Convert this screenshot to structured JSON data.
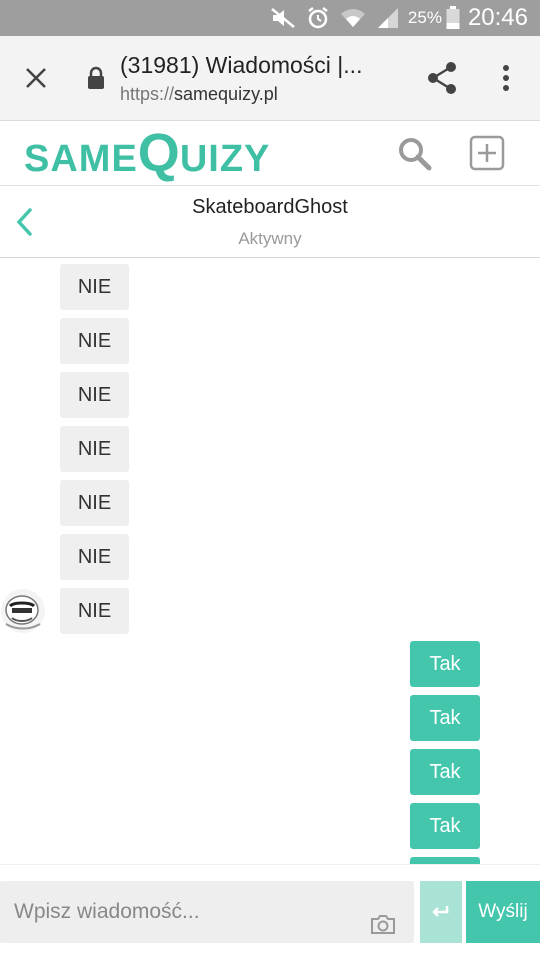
{
  "status_bar": {
    "battery_percent": "25%",
    "time": "20:46",
    "icons": [
      "mute-icon",
      "alarm-icon",
      "wifi-icon",
      "signal-icon",
      "battery-icon"
    ]
  },
  "browser": {
    "tab_title": "(31981) Wiadomości |...",
    "url_protocol": "https://",
    "url_host": "samequizy.pl",
    "icons": [
      "close-icon",
      "lock-icon",
      "share-icon",
      "more-vert-icon"
    ]
  },
  "site": {
    "logo_part1": "SAME",
    "logo_part2": "Q",
    "logo_part3": "UIZY",
    "icons": [
      "search-icon",
      "add-box-icon"
    ]
  },
  "conversation": {
    "name": "SkateboardGhost",
    "status": "Aktywny",
    "back_icon": "chevron-left-icon"
  },
  "messages": {
    "incoming": [
      "NIE",
      "NIE",
      "NIE",
      "NIE",
      "NIE",
      "NIE",
      "NIE"
    ],
    "outgoing": [
      "Tak",
      "Tak",
      "Tak",
      "Tak",
      ""
    ]
  },
  "composer": {
    "placeholder": "Wpisz wiadomość...",
    "send_label": "Wyślij",
    "icons": [
      "camera-icon",
      "enter-icon"
    ]
  },
  "colors": {
    "accent": "#44c6ac",
    "accent_light": "#a8e3d5",
    "status_bar": "#9e9e9e",
    "incoming_bubble": "#efefef"
  }
}
